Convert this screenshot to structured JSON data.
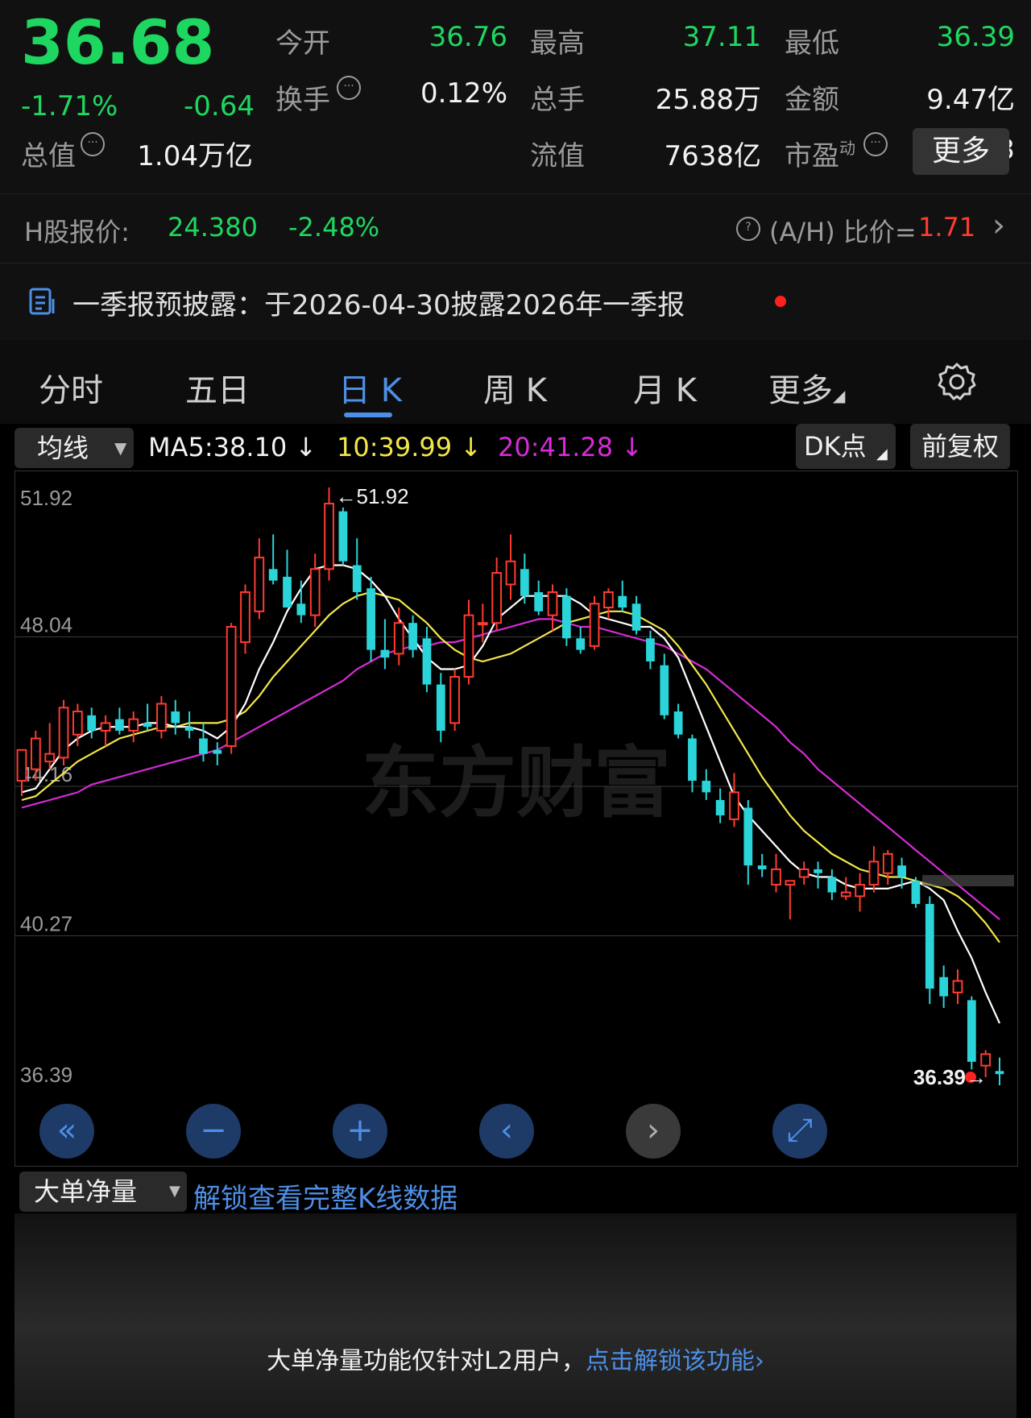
{
  "quote": {
    "price": "36.68",
    "change_pct": "-1.71%",
    "change": "-0.64",
    "stats": [
      {
        "label": "今开",
        "value": "36.76",
        "tone": "green"
      },
      {
        "label": "最高",
        "value": "37.11",
        "tone": "green"
      },
      {
        "label": "最低",
        "value": "36.39",
        "tone": "green"
      },
      {
        "label": "换手",
        "value": "0.12%",
        "tone": "white"
      },
      {
        "label": "总手",
        "value": "25.88万",
        "tone": "white"
      },
      {
        "label": "金额",
        "value": "9.47亿",
        "tone": "white"
      },
      {
        "label": "总值",
        "value": "1.04万亿",
        "tone": "white"
      },
      {
        "label": "流值",
        "value": "7638亿",
        "tone": "white"
      },
      {
        "label": "市盈",
        "sup": "动",
        "value": "6.73",
        "tone": "white"
      }
    ],
    "more_label": "更多"
  },
  "hshare": {
    "label": "H股报价:",
    "price": "24.380",
    "change_pct": "-2.48%",
    "ratio_label": "(A/H) 比价=",
    "ratio_value": "1.71"
  },
  "report": {
    "text": "一季报预披露：于2026-04-30披露2026年一季报"
  },
  "tabs": [
    {
      "label": "分时",
      "active": false
    },
    {
      "label": "五日",
      "active": false
    },
    {
      "label": "日 K",
      "active": true
    },
    {
      "label": "周 K",
      "active": false
    },
    {
      "label": "月 K",
      "active": false
    },
    {
      "label": "更多",
      "active": false
    }
  ],
  "ma_bar": {
    "dropdown": "均线",
    "ma5": "MA5:38.10",
    "ma10": "10:39.99",
    "ma20": "20:41.28",
    "dk_label": "DK点",
    "adjust_label": "前复权"
  },
  "chart_data": {
    "type": "candlestick",
    "y_ticks": [
      "51.92",
      "48.04",
      "44.16",
      "40.27",
      "36.39"
    ],
    "ylim": [
      36.39,
      51.92
    ],
    "max_label": "51.92",
    "min_label": "36.39",
    "watermark": "东方财富",
    "colors": {
      "up": "#ff3b30",
      "down": "#2ad4d9",
      "ma5": "#ffffff",
      "ma10": "#f2e64a",
      "ma20": "#d62bd6"
    },
    "candles": [
      {
        "o": 44.3,
        "h": 44.8,
        "l": 43.9,
        "c": 45.1,
        "dir": "up"
      },
      {
        "o": 44.6,
        "h": 45.6,
        "l": 44.3,
        "c": 45.4,
        "dir": "up"
      },
      {
        "o": 44.8,
        "h": 45.8,
        "l": 44.6,
        "c": 45.0,
        "dir": "up"
      },
      {
        "o": 44.9,
        "h": 46.4,
        "l": 44.7,
        "c": 46.2,
        "dir": "up"
      },
      {
        "o": 45.5,
        "h": 46.3,
        "l": 45.2,
        "c": 46.1,
        "dir": "up"
      },
      {
        "o": 46.0,
        "h": 46.2,
        "l": 45.4,
        "c": 45.6,
        "dir": "down"
      },
      {
        "o": 45.6,
        "h": 46.0,
        "l": 45.2,
        "c": 45.8,
        "dir": "up"
      },
      {
        "o": 45.9,
        "h": 46.2,
        "l": 45.5,
        "c": 45.6,
        "dir": "down"
      },
      {
        "o": 45.6,
        "h": 46.1,
        "l": 45.3,
        "c": 45.9,
        "dir": "up"
      },
      {
        "o": 45.8,
        "h": 46.3,
        "l": 45.6,
        "c": 45.7,
        "dir": "down"
      },
      {
        "o": 45.6,
        "h": 46.5,
        "l": 45.4,
        "c": 46.3,
        "dir": "up"
      },
      {
        "o": 46.1,
        "h": 46.4,
        "l": 45.5,
        "c": 45.8,
        "dir": "down"
      },
      {
        "o": 45.7,
        "h": 46.1,
        "l": 45.4,
        "c": 45.6,
        "dir": "down"
      },
      {
        "o": 45.4,
        "h": 45.8,
        "l": 44.8,
        "c": 45.0,
        "dir": "down"
      },
      {
        "o": 45.0,
        "h": 45.3,
        "l": 44.7,
        "c": 45.1,
        "dir": "down"
      },
      {
        "o": 45.2,
        "h": 48.4,
        "l": 45.0,
        "c": 48.3,
        "dir": "up"
      },
      {
        "o": 47.9,
        "h": 49.4,
        "l": 47.6,
        "c": 49.2,
        "dir": "up"
      },
      {
        "o": 48.7,
        "h": 50.6,
        "l": 48.5,
        "c": 50.1,
        "dir": "up"
      },
      {
        "o": 49.8,
        "h": 50.7,
        "l": 49.4,
        "c": 49.5,
        "dir": "down"
      },
      {
        "o": 49.6,
        "h": 50.3,
        "l": 48.9,
        "c": 48.8,
        "dir": "down"
      },
      {
        "o": 48.9,
        "h": 49.5,
        "l": 48.4,
        "c": 48.6,
        "dir": "down"
      },
      {
        "o": 48.6,
        "h": 50.2,
        "l": 48.3,
        "c": 49.8,
        "dir": "up"
      },
      {
        "o": 49.8,
        "h": 51.92,
        "l": 49.5,
        "c": 51.5,
        "dir": "up"
      },
      {
        "o": 51.3,
        "h": 51.4,
        "l": 49.9,
        "c": 50.0,
        "dir": "down"
      },
      {
        "o": 49.9,
        "h": 50.6,
        "l": 49.0,
        "c": 49.2,
        "dir": "down"
      },
      {
        "o": 49.3,
        "h": 49.6,
        "l": 47.4,
        "c": 47.7,
        "dir": "down"
      },
      {
        "o": 47.7,
        "h": 48.5,
        "l": 47.2,
        "c": 47.5,
        "dir": "down"
      },
      {
        "o": 47.6,
        "h": 48.8,
        "l": 47.3,
        "c": 48.4,
        "dir": "up"
      },
      {
        "o": 48.4,
        "h": 48.6,
        "l": 47.5,
        "c": 47.7,
        "dir": "down"
      },
      {
        "o": 48.0,
        "h": 48.3,
        "l": 46.6,
        "c": 46.8,
        "dir": "down"
      },
      {
        "o": 46.8,
        "h": 47.1,
        "l": 45.3,
        "c": 45.6,
        "dir": "down"
      },
      {
        "o": 45.8,
        "h": 47.2,
        "l": 45.6,
        "c": 47.0,
        "dir": "up"
      },
      {
        "o": 47.0,
        "h": 49.0,
        "l": 46.8,
        "c": 48.6,
        "dir": "up"
      },
      {
        "o": 48.4,
        "h": 48.9,
        "l": 47.9,
        "c": 48.4,
        "dir": "up"
      },
      {
        "o": 48.4,
        "h": 50.1,
        "l": 48.2,
        "c": 49.7,
        "dir": "up"
      },
      {
        "o": 49.4,
        "h": 50.7,
        "l": 49.0,
        "c": 50.0,
        "dir": "up"
      },
      {
        "o": 49.8,
        "h": 50.2,
        "l": 48.9,
        "c": 49.1,
        "dir": "down"
      },
      {
        "o": 49.2,
        "h": 49.5,
        "l": 48.6,
        "c": 48.7,
        "dir": "down"
      },
      {
        "o": 48.6,
        "h": 49.4,
        "l": 48.2,
        "c": 49.2,
        "dir": "up"
      },
      {
        "o": 49.1,
        "h": 49.3,
        "l": 47.8,
        "c": 48.0,
        "dir": "down"
      },
      {
        "o": 48.0,
        "h": 48.3,
        "l": 47.6,
        "c": 47.7,
        "dir": "down"
      },
      {
        "o": 47.8,
        "h": 49.1,
        "l": 47.7,
        "c": 48.9,
        "dir": "up"
      },
      {
        "o": 48.8,
        "h": 49.3,
        "l": 48.5,
        "c": 49.2,
        "dir": "up"
      },
      {
        "o": 49.1,
        "h": 49.5,
        "l": 48.7,
        "c": 48.8,
        "dir": "down"
      },
      {
        "o": 48.9,
        "h": 49.1,
        "l": 48.1,
        "c": 48.2,
        "dir": "down"
      },
      {
        "o": 48.0,
        "h": 48.2,
        "l": 47.2,
        "c": 47.4,
        "dir": "down"
      },
      {
        "o": 47.3,
        "h": 47.6,
        "l": 45.9,
        "c": 46.0,
        "dir": "down"
      },
      {
        "o": 46.1,
        "h": 46.3,
        "l": 45.4,
        "c": 45.5,
        "dir": "down"
      },
      {
        "o": 45.4,
        "h": 45.5,
        "l": 44.0,
        "c": 44.3,
        "dir": "down"
      },
      {
        "o": 44.3,
        "h": 44.6,
        "l": 43.8,
        "c": 44.0,
        "dir": "down"
      },
      {
        "o": 43.8,
        "h": 44.1,
        "l": 43.2,
        "c": 43.4,
        "dir": "down"
      },
      {
        "o": 43.3,
        "h": 44.5,
        "l": 43.1,
        "c": 44.0,
        "dir": "up"
      },
      {
        "o": 43.6,
        "h": 43.8,
        "l": 41.6,
        "c": 42.1,
        "dir": "down"
      },
      {
        "o": 42.1,
        "h": 42.4,
        "l": 41.8,
        "c": 42.0,
        "dir": "down"
      },
      {
        "o": 41.6,
        "h": 42.4,
        "l": 41.4,
        "c": 42.0,
        "dir": "up"
      },
      {
        "o": 41.6,
        "h": 41.7,
        "l": 40.7,
        "c": 41.7,
        "dir": "up"
      },
      {
        "o": 41.8,
        "h": 42.2,
        "l": 41.6,
        "c": 42.0,
        "dir": "up"
      },
      {
        "o": 42.0,
        "h": 42.2,
        "l": 41.5,
        "c": 41.9,
        "dir": "down"
      },
      {
        "o": 41.8,
        "h": 42.0,
        "l": 41.2,
        "c": 41.4,
        "dir": "down"
      },
      {
        "o": 41.3,
        "h": 41.8,
        "l": 41.2,
        "c": 41.4,
        "dir": "up"
      },
      {
        "o": 41.3,
        "h": 41.9,
        "l": 40.9,
        "c": 41.6,
        "dir": "up"
      },
      {
        "o": 41.6,
        "h": 42.6,
        "l": 41.4,
        "c": 42.2,
        "dir": "up"
      },
      {
        "o": 41.9,
        "h": 42.5,
        "l": 41.6,
        "c": 42.4,
        "dir": "up"
      },
      {
        "o": 42.1,
        "h": 42.3,
        "l": 41.5,
        "c": 41.8,
        "dir": "down"
      },
      {
        "o": 41.7,
        "h": 41.8,
        "l": 41.0,
        "c": 41.1,
        "dir": "down"
      },
      {
        "o": 41.1,
        "h": 41.3,
        "l": 38.5,
        "c": 38.9,
        "dir": "down"
      },
      {
        "o": 39.2,
        "h": 39.5,
        "l": 38.4,
        "c": 38.7,
        "dir": "down"
      },
      {
        "o": 38.8,
        "h": 39.4,
        "l": 38.5,
        "c": 39.1,
        "dir": "up"
      },
      {
        "o": 38.6,
        "h": 38.7,
        "l": 36.8,
        "c": 37.0,
        "dir": "down"
      },
      {
        "o": 36.9,
        "h": 37.3,
        "l": 36.6,
        "c": 37.2,
        "dir": "up"
      },
      {
        "o": 36.76,
        "h": 37.11,
        "l": 36.39,
        "c": 36.68,
        "dir": "down"
      }
    ],
    "ma5": [
      44.0,
      44.1,
      44.6,
      45.1,
      45.4,
      45.6,
      45.7,
      45.7,
      45.7,
      45.8,
      45.8,
      45.7,
      45.7,
      45.6,
      45.4,
      45.7,
      46.3,
      47.2,
      47.9,
      48.7,
      49.3,
      49.8,
      49.9,
      49.9,
      49.8,
      49.5,
      49.1,
      48.5,
      48.0,
      47.5,
      47.2,
      47.2,
      47.3,
      47.8,
      48.5,
      48.8,
      49.1,
      49.1,
      49.1,
      49.1,
      48.9,
      48.6,
      48.5,
      48.4,
      48.3,
      48.3,
      48.0,
      47.5,
      46.6,
      45.7,
      44.8,
      43.9,
      43.4,
      43.0,
      42.6,
      42.2,
      41.9,
      41.8,
      41.8,
      41.6,
      41.5,
      41.5,
      41.5,
      41.6,
      41.7,
      41.5,
      41.2,
      40.4,
      39.7,
      38.8,
      38.0
    ],
    "ma10": [
      43.8,
      43.9,
      44.2,
      44.5,
      44.8,
      45.0,
      45.2,
      45.4,
      45.5,
      45.6,
      45.7,
      45.7,
      45.8,
      45.8,
      45.8,
      45.9,
      46.1,
      46.5,
      47.0,
      47.4,
      47.8,
      48.2,
      48.6,
      48.9,
      49.1,
      49.2,
      49.1,
      49.0,
      48.7,
      48.4,
      48.0,
      47.7,
      47.5,
      47.4,
      47.5,
      47.6,
      47.8,
      48.0,
      48.2,
      48.4,
      48.5,
      48.6,
      48.7,
      48.7,
      48.6,
      48.4,
      48.2,
      47.8,
      47.3,
      46.8,
      46.2,
      45.6,
      45.0,
      44.4,
      43.9,
      43.4,
      43.0,
      42.7,
      42.4,
      42.2,
      42.0,
      41.9,
      41.8,
      41.8,
      41.7,
      41.6,
      41.5,
      41.3,
      41.0,
      40.6,
      40.1
    ],
    "ma20": [
      43.6,
      43.7,
      43.8,
      43.9,
      44.0,
      44.2,
      44.3,
      44.4,
      44.5,
      44.6,
      44.7,
      44.8,
      44.9,
      45.0,
      45.1,
      45.3,
      45.5,
      45.7,
      45.9,
      46.1,
      46.3,
      46.5,
      46.7,
      46.9,
      47.2,
      47.4,
      47.6,
      47.7,
      47.8,
      47.8,
      47.9,
      47.9,
      48.0,
      48.1,
      48.2,
      48.3,
      48.4,
      48.5,
      48.5,
      48.4,
      48.3,
      48.3,
      48.2,
      48.1,
      48.0,
      47.9,
      47.8,
      47.6,
      47.4,
      47.2,
      46.9,
      46.6,
      46.3,
      46.0,
      45.7,
      45.3,
      45.0,
      44.6,
      44.3,
      44.0,
      43.7,
      43.4,
      43.1,
      42.8,
      42.5,
      42.2,
      41.9,
      41.6,
      41.3,
      41.0,
      40.7
    ]
  },
  "chart_controls": [
    {
      "name": "scroll-left-fast-button",
      "glyph": "«",
      "tone": "blue"
    },
    {
      "name": "zoom-out-button",
      "glyph": "−",
      "tone": "blue"
    },
    {
      "name": "zoom-in-button",
      "glyph": "+",
      "tone": "blue"
    },
    {
      "name": "scroll-left-button",
      "glyph": "‹",
      "tone": "blue"
    },
    {
      "name": "scroll-right-button",
      "glyph": "›",
      "tone": "gray"
    },
    {
      "name": "fullscreen-button",
      "glyph": "⤢",
      "tone": "blue"
    }
  ],
  "big_order": {
    "dropdown": "大单净量",
    "unlock_link": "解锁查看完整K线数据",
    "notice_text": "大单净量功能仅针对L2用户，",
    "notice_link": "点击解锁该功能"
  }
}
